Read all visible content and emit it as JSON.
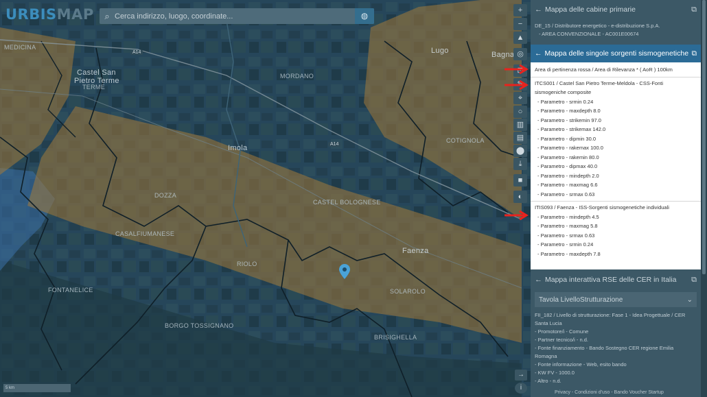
{
  "app": {
    "logo_part1": "URBIS",
    "logo_part2": "MAP"
  },
  "search": {
    "placeholder": "Cerca indirizzo, luogo, coordinate...",
    "icon": "search-icon",
    "action_icon": "globe-icon"
  },
  "map": {
    "labels": [
      {
        "text": "Castel San",
        "cls": "town"
      },
      {
        "text": "Pietro Terme",
        "cls": "town"
      },
      {
        "text": "Imola",
        "cls": "town"
      },
      {
        "text": "Lugo",
        "cls": "town"
      },
      {
        "text": "Faenza",
        "cls": "town"
      },
      {
        "text": "Bagna",
        "cls": "town"
      },
      {
        "text": "CASALFIUMANESE",
        "cls": ""
      },
      {
        "text": "DOZZA",
        "cls": ""
      },
      {
        "text": "RIOLO",
        "cls": ""
      },
      {
        "text": "BRISIGHELLA",
        "cls": ""
      },
      {
        "text": "SOLAROLO",
        "cls": ""
      },
      {
        "text": "FONTANELICE",
        "cls": ""
      },
      {
        "text": "MORDANO",
        "cls": ""
      },
      {
        "text": "CASTEL BOLOGNESE",
        "cls": ""
      },
      {
        "text": "TERME",
        "cls": ""
      },
      {
        "text": "MEDICINA",
        "cls": ""
      },
      {
        "text": "COTIGNOLA",
        "cls": ""
      },
      {
        "text": "BORGO TOSSIGNANO",
        "cls": ""
      }
    ],
    "road_a14_1": "A14",
    "road_a14_2": "A14",
    "scale_text": "5 km",
    "pin_icon": "map-pin-icon"
  },
  "toolbar": {
    "zoom_in": "+",
    "zoom_out": "−",
    "compass": "▲",
    "locate": "◎",
    "tool_a": "⊡",
    "tool_b": "✎",
    "tool_c": "⌖",
    "tool_d": "○",
    "tool_e": "▥",
    "tool_f": "▤",
    "tool_g": "⬤",
    "tool_h": "⤓",
    "tool_i": "■",
    "tool_j": "◐",
    "bottom_arrow": "→",
    "bottom_info": "i"
  },
  "panel": {
    "section1": {
      "title": "Mappa delle cabine primarie",
      "line1": "DE_15 / Distributore energetico - e-distribuzione S.p.A.",
      "line2": "- AREA CONVENZIONALE - AC001E00674"
    },
    "section2": {
      "title": "Mappa delle singole sorgenti sismogenetiche",
      "area_line": "Area di pertinenza rossa / Area di Rilevanza * ( AoR ) 100km",
      "group1_title1": "ITCS001 / Castel San Pietro Terme-Meldola - CSS-Fonti",
      "group1_title2": "sismogeniche composite",
      "group1_params": [
        "- Parametro - srmin 0.24",
        "- Parametro - maxdepth 8.0",
        "- Parametro - strikemin 97.0",
        "- Parametro - strikemax 142.0",
        "- Parametro - dipmin 30.0",
        "- Parametro - rakemax 100.0",
        "- Parametro - rakemin 80.0",
        "- Parametro - dipmax 40.0",
        "- Parametro - mindepth 2.0",
        "- Parametro - maxmag 6.6",
        "- Parametro - srmax 0.63"
      ],
      "group2_title": "ITIS093 / Faenza - ISS-Sorgenti sismogenetiche individuali",
      "group2_params": [
        "- Parametro - mindepth 4.5",
        "- Parametro - maxmag 5.8",
        "- Parametro - srmax 0.63",
        "- Parametro - srmin 0.24",
        "- Parametro - maxdepth 7.8"
      ]
    },
    "section3": {
      "title": "Mappa interattiva RSE delle CER in Italia",
      "select_value": "Tavola LivelloStrutturazione",
      "lines": [
        "FII_182 / Livello di strutturazione: Fase 1 - Idea Progettuale / CER",
        "Santa Lucia",
        "- Promotore/i - Comune",
        "- Partner tecnico/i - n.d.",
        "- Fonte finanziamento - Bando Sostegno CER regione Emilia",
        "Romagna",
        "- Fonte informazione - Web, esito bando",
        "- KW FV - 1000.0",
        "- Altro - n.d."
      ]
    },
    "footer": "Privacy - Condizioni d'uso - Bando Voucher Startup"
  },
  "colors": {
    "accent": "#2b6b96",
    "hazard_zone": "#a27a3a",
    "blue_zone": "#3b6fa6",
    "arrow": "#e8231e"
  }
}
